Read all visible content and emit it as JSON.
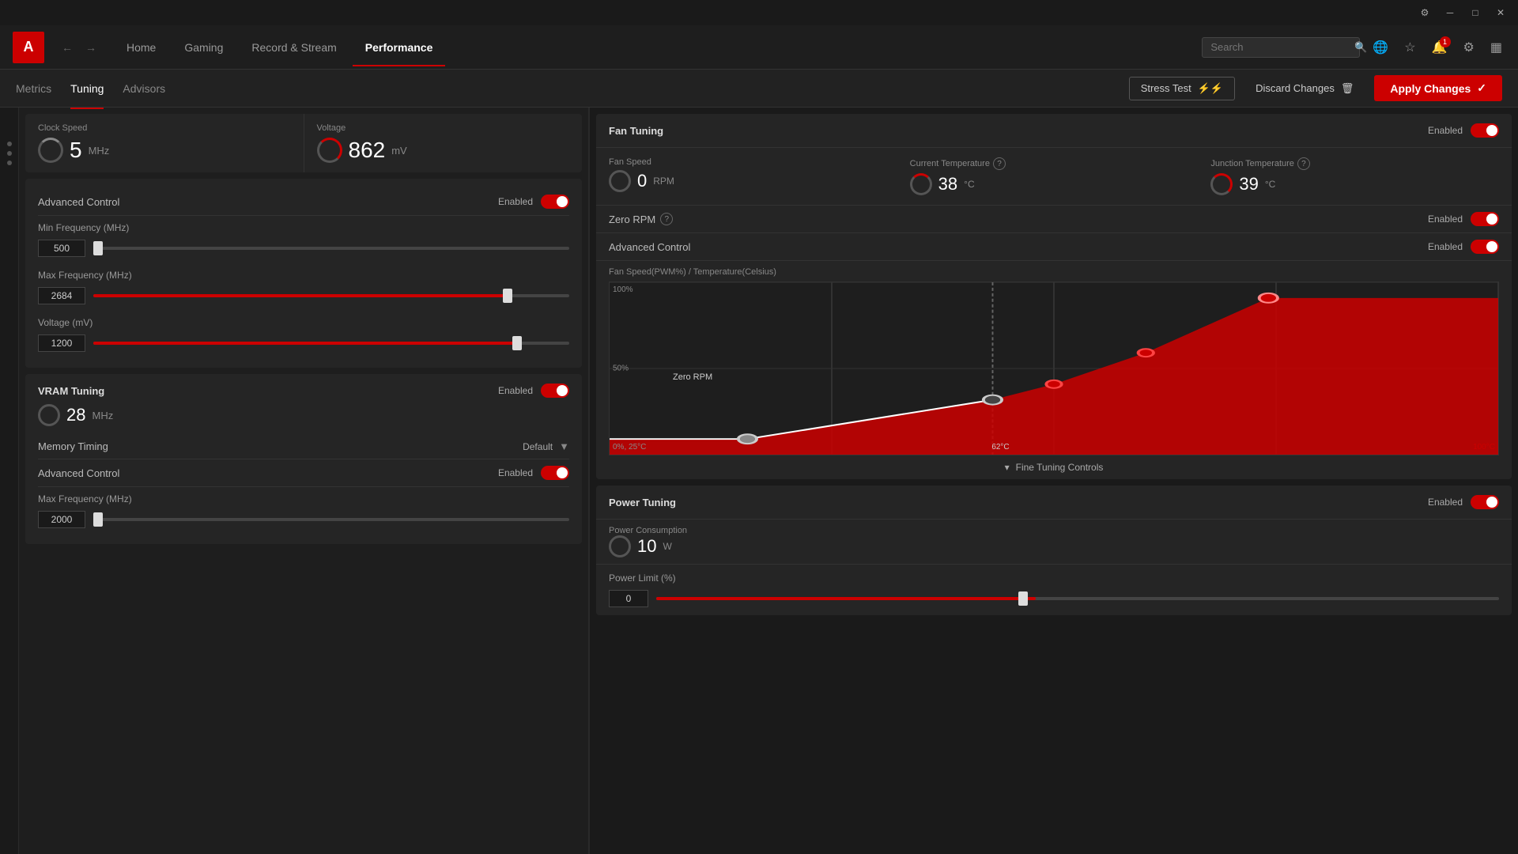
{
  "titlebar": {
    "btns": [
      "─",
      "□",
      "✕"
    ]
  },
  "navbar": {
    "logo": "A",
    "links": [
      "Home",
      "Gaming",
      "Record & Stream",
      "Performance"
    ],
    "active_link": "Performance",
    "search_placeholder": "Search",
    "notif_count": "1"
  },
  "toolbar": {
    "tabs": [
      "Metrics",
      "Tuning",
      "Advisors"
    ],
    "active_tab": "Tuning",
    "stress_test_label": "Stress Test",
    "discard_label": "Discard Changes",
    "apply_label": "Apply Changes"
  },
  "left_panel": {
    "clock_speed": {
      "label": "Clock Speed",
      "value": "5",
      "unit": "MHz"
    },
    "voltage": {
      "label": "Voltage",
      "value": "862",
      "unit": "mV"
    },
    "advanced_control": {
      "label": "Advanced Control",
      "status": "Enabled",
      "on": true
    },
    "min_frequency": {
      "label": "Min Frequency (MHz)",
      "value": "500",
      "fill_percent": 1
    },
    "max_frequency": {
      "label": "Max Frequency (MHz)",
      "value": "2684",
      "fill_percent": 88
    },
    "voltage_mv": {
      "label": "Voltage (mV)",
      "value": "1200",
      "fill_percent": 90
    },
    "vram_tuning": {
      "section_title": "VRAM Tuning",
      "status": "Enabled",
      "on": true,
      "clock_speed_label": "Clock Speed",
      "clock_speed_value": "28",
      "clock_speed_unit": "MHz",
      "memory_timing_label": "Memory Timing",
      "memory_timing_value": "Default",
      "advanced_control_label": "Advanced Control",
      "advanced_control_status": "Enabled",
      "advanced_control_on": true,
      "max_freq_label": "Max Frequency (MHz)",
      "max_freq_value": "2000",
      "max_freq_fill": 1
    }
  },
  "right_panel": {
    "fan_tuning": {
      "title": "Fan Tuning",
      "enabled_label": "Enabled",
      "enabled": true,
      "fan_speed_label": "Fan Speed",
      "fan_speed_value": "0",
      "fan_speed_unit": "RPM",
      "current_temp_label": "Current Temperature",
      "current_temp_value": "38",
      "current_temp_unit": "°C",
      "junction_temp_label": "Junction Temperature",
      "junction_temp_value": "39",
      "junction_temp_unit": "°C",
      "zero_rpm_label": "Zero RPM",
      "zero_rpm_enabled": "Enabled",
      "zero_rpm_on": true,
      "advanced_control_label": "Advanced Control",
      "advanced_control_enabled": "Enabled",
      "advanced_control_on": true,
      "chart_title": "Fan Speed(PWM%) / Temperature(Celsius)",
      "chart_y_top": "100%",
      "chart_y_mid": "50%",
      "chart_x_left": "0%, 25°C",
      "chart_x_mid": "62°C",
      "chart_x_right": "100°C",
      "zero_rpm_chart_label": "Zero RPM",
      "fine_tuning_label": "Fine Tuning Controls"
    },
    "power_tuning": {
      "title": "Power Tuning",
      "enabled_label": "Enabled",
      "enabled": true,
      "power_consumption_label": "Power Consumption",
      "power_value": "10",
      "power_unit": "W",
      "power_limit_label": "Power Limit (%)",
      "power_limit_value": "0",
      "power_limit_fill": 45
    }
  }
}
